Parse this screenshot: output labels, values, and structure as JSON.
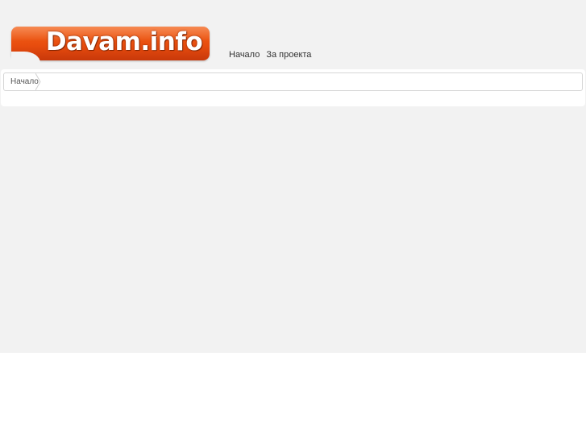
{
  "logo": {
    "text": "Davam.info",
    "color": "#e84d0e"
  },
  "nav": {
    "items": [
      {
        "label": "Начало"
      },
      {
        "label": "За проекта"
      }
    ]
  },
  "breadcrumb": {
    "items": [
      {
        "label": "Начало"
      }
    ]
  },
  "colors": {
    "background": "#f2f2f2",
    "accent": "#e84d0e",
    "text": "#333333"
  }
}
